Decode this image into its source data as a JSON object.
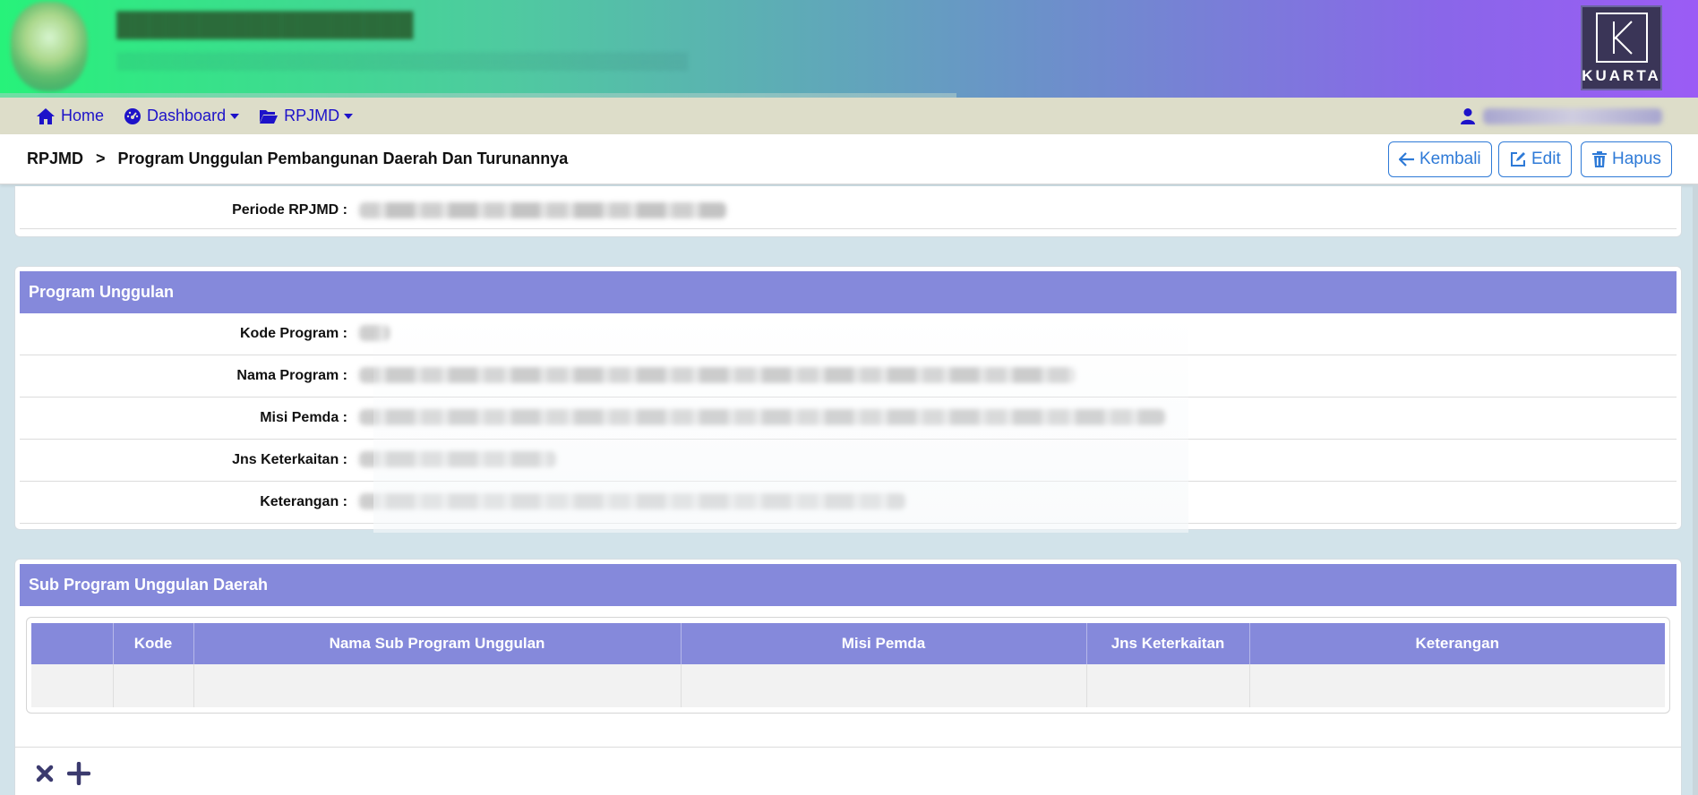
{
  "nav": {
    "home": "Home",
    "dashboard": "Dashboard",
    "rpjmd": "RPJMD"
  },
  "logo": {
    "brand": "KUARTA"
  },
  "breadcrumb": {
    "root": "RPJMD",
    "separator": ">",
    "current": "Program Unggulan Pembangunan Daerah Dan Turunannya"
  },
  "actions": {
    "back": "Kembali",
    "edit": "Edit",
    "delete": "Hapus"
  },
  "periode": {
    "label": "Periode RPJMD :"
  },
  "program": {
    "header": "Program Unggulan",
    "fields": [
      {
        "label": "Kode Program :"
      },
      {
        "label": "Nama Program :"
      },
      {
        "label": "Misi Pemda :"
      },
      {
        "label": "Jns Keterkaitan :"
      },
      {
        "label": "Keterangan :"
      }
    ]
  },
  "sub_program": {
    "header": "Sub Program Unggulan Daerah",
    "columns": [
      "",
      "Kode",
      "Nama Sub Program Unggulan",
      "Misi Pemda",
      "Jns Keterkaitan",
      "Keterangan"
    ]
  },
  "icons": {
    "home": "home-icon",
    "dashboard": "dashboard-icon",
    "folder": "folder-open-icon",
    "user": "user-icon",
    "back": "arrow-left-icon",
    "edit": "edit-icon",
    "delete": "trash-icon",
    "remove": "close-icon",
    "add": "plus-icon"
  },
  "colors": {
    "header_bg": "#8589db",
    "nav_link": "#1d12c9",
    "button": "#2e7ad7",
    "navbar_bg": "#ddddc9",
    "page_bg": "#d2e3ea"
  }
}
